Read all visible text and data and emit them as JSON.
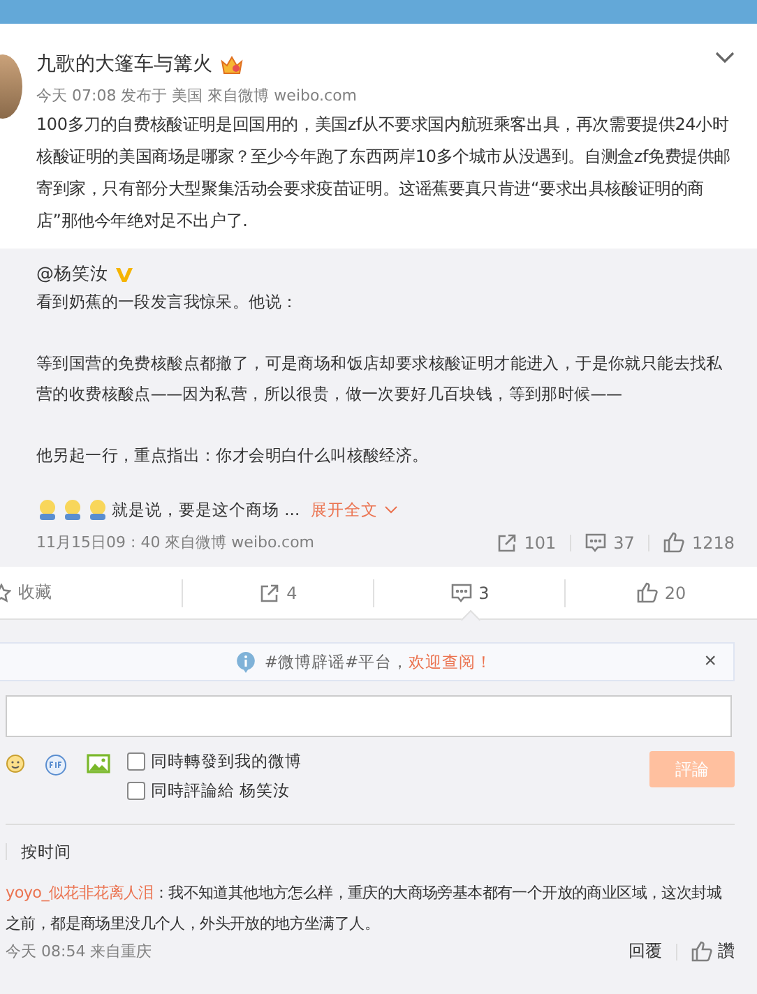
{
  "post": {
    "author": "九歌的大篷车与篝火",
    "meta": "今天 07:08 发布于 美国 來自微博 weibo.com",
    "text": "100多刀的自费核酸证明是回国用的，美国zf从不要求国内航班乘客出具，再次需要提供24小时核酸证明的美国商场是哪家？至少今年跑了东西两岸10多个城市从没遇到。自测盒zf免费提供邮寄到家，只有部分大型聚集活动会要求疫苗证明。这谣蕉要真只肯进“要求出具核酸证明的商店”那他今年绝对足不出户了."
  },
  "repost": {
    "author": "@杨笑汝",
    "paragraphs": [
      "看到奶蕉的一段发言我惊呆。他说：",
      "等到国营的免费核酸点都撤了，可是商场和饭店却要求核酸证明才能进入，于是你就只能去找私营的收费核酸点——因为私营，所以很贵，做一次要好几百块钱，等到那时候——",
      "他另起一行，重点指出：你才会明白什么叫核酸经济。"
    ],
    "last_line": "就是说，要是这个商场 ...",
    "expand": "展开全文",
    "meta": "11月15日09 : 40 來自微博 weibo.com",
    "stats": [
      {
        "kind": "repost",
        "count": "101"
      },
      {
        "kind": "comment",
        "count": "37"
      },
      {
        "kind": "like",
        "count": "1218"
      }
    ]
  },
  "actions": [
    {
      "kind": "favorite",
      "label": "收藏",
      "selected": false
    },
    {
      "kind": "repost",
      "label": "4",
      "selected": false
    },
    {
      "kind": "comment",
      "label": "3",
      "selected": true
    },
    {
      "kind": "like",
      "label": "20",
      "selected": false
    }
  ],
  "notice": {
    "text": "#微博辟谣#平台，",
    "link": "欢迎查阅！",
    "close": "×"
  },
  "composer": {
    "options": [
      {
        "label": "同時轉發到我的微博",
        "checked": false
      },
      {
        "label": "同時評論給 杨笑汝",
        "checked": false
      }
    ],
    "submit": "評論",
    "submit_disabled": true
  },
  "sort": {
    "label": "按时间"
  },
  "comments": [
    {
      "user": "yoyo_似花非花离人泪",
      "text": "：我不知道其他地方怎么样，重庆的大商场旁基本都有一个开放的商业区域，这次封城之前，都是商场里没几个人，外头开放的地方坐满了人。",
      "meta": "今天 08:54 来自重庆",
      "reply": "回覆",
      "like": "讚"
    }
  ]
}
